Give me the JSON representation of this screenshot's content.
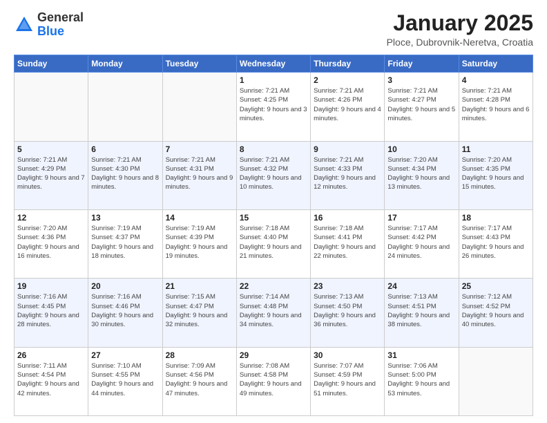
{
  "logo": {
    "general": "General",
    "blue": "Blue"
  },
  "header": {
    "month": "January 2025",
    "location": "Ploce, Dubrovnik-Neretva, Croatia"
  },
  "weekdays": [
    "Sunday",
    "Monday",
    "Tuesday",
    "Wednesday",
    "Thursday",
    "Friday",
    "Saturday"
  ],
  "weeks": [
    [
      {
        "day": "",
        "info": ""
      },
      {
        "day": "",
        "info": ""
      },
      {
        "day": "",
        "info": ""
      },
      {
        "day": "1",
        "info": "Sunrise: 7:21 AM\nSunset: 4:25 PM\nDaylight: 9 hours and 3 minutes."
      },
      {
        "day": "2",
        "info": "Sunrise: 7:21 AM\nSunset: 4:26 PM\nDaylight: 9 hours and 4 minutes."
      },
      {
        "day": "3",
        "info": "Sunrise: 7:21 AM\nSunset: 4:27 PM\nDaylight: 9 hours and 5 minutes."
      },
      {
        "day": "4",
        "info": "Sunrise: 7:21 AM\nSunset: 4:28 PM\nDaylight: 9 hours and 6 minutes."
      }
    ],
    [
      {
        "day": "5",
        "info": "Sunrise: 7:21 AM\nSunset: 4:29 PM\nDaylight: 9 hours and 7 minutes."
      },
      {
        "day": "6",
        "info": "Sunrise: 7:21 AM\nSunset: 4:30 PM\nDaylight: 9 hours and 8 minutes."
      },
      {
        "day": "7",
        "info": "Sunrise: 7:21 AM\nSunset: 4:31 PM\nDaylight: 9 hours and 9 minutes."
      },
      {
        "day": "8",
        "info": "Sunrise: 7:21 AM\nSunset: 4:32 PM\nDaylight: 9 hours and 10 minutes."
      },
      {
        "day": "9",
        "info": "Sunrise: 7:21 AM\nSunset: 4:33 PM\nDaylight: 9 hours and 12 minutes."
      },
      {
        "day": "10",
        "info": "Sunrise: 7:20 AM\nSunset: 4:34 PM\nDaylight: 9 hours and 13 minutes."
      },
      {
        "day": "11",
        "info": "Sunrise: 7:20 AM\nSunset: 4:35 PM\nDaylight: 9 hours and 15 minutes."
      }
    ],
    [
      {
        "day": "12",
        "info": "Sunrise: 7:20 AM\nSunset: 4:36 PM\nDaylight: 9 hours and 16 minutes."
      },
      {
        "day": "13",
        "info": "Sunrise: 7:19 AM\nSunset: 4:37 PM\nDaylight: 9 hours and 18 minutes."
      },
      {
        "day": "14",
        "info": "Sunrise: 7:19 AM\nSunset: 4:39 PM\nDaylight: 9 hours and 19 minutes."
      },
      {
        "day": "15",
        "info": "Sunrise: 7:18 AM\nSunset: 4:40 PM\nDaylight: 9 hours and 21 minutes."
      },
      {
        "day": "16",
        "info": "Sunrise: 7:18 AM\nSunset: 4:41 PM\nDaylight: 9 hours and 22 minutes."
      },
      {
        "day": "17",
        "info": "Sunrise: 7:17 AM\nSunset: 4:42 PM\nDaylight: 9 hours and 24 minutes."
      },
      {
        "day": "18",
        "info": "Sunrise: 7:17 AM\nSunset: 4:43 PM\nDaylight: 9 hours and 26 minutes."
      }
    ],
    [
      {
        "day": "19",
        "info": "Sunrise: 7:16 AM\nSunset: 4:45 PM\nDaylight: 9 hours and 28 minutes."
      },
      {
        "day": "20",
        "info": "Sunrise: 7:16 AM\nSunset: 4:46 PM\nDaylight: 9 hours and 30 minutes."
      },
      {
        "day": "21",
        "info": "Sunrise: 7:15 AM\nSunset: 4:47 PM\nDaylight: 9 hours and 32 minutes."
      },
      {
        "day": "22",
        "info": "Sunrise: 7:14 AM\nSunset: 4:48 PM\nDaylight: 9 hours and 34 minutes."
      },
      {
        "day": "23",
        "info": "Sunrise: 7:13 AM\nSunset: 4:50 PM\nDaylight: 9 hours and 36 minutes."
      },
      {
        "day": "24",
        "info": "Sunrise: 7:13 AM\nSunset: 4:51 PM\nDaylight: 9 hours and 38 minutes."
      },
      {
        "day": "25",
        "info": "Sunrise: 7:12 AM\nSunset: 4:52 PM\nDaylight: 9 hours and 40 minutes."
      }
    ],
    [
      {
        "day": "26",
        "info": "Sunrise: 7:11 AM\nSunset: 4:54 PM\nDaylight: 9 hours and 42 minutes."
      },
      {
        "day": "27",
        "info": "Sunrise: 7:10 AM\nSunset: 4:55 PM\nDaylight: 9 hours and 44 minutes."
      },
      {
        "day": "28",
        "info": "Sunrise: 7:09 AM\nSunset: 4:56 PM\nDaylight: 9 hours and 47 minutes."
      },
      {
        "day": "29",
        "info": "Sunrise: 7:08 AM\nSunset: 4:58 PM\nDaylight: 9 hours and 49 minutes."
      },
      {
        "day": "30",
        "info": "Sunrise: 7:07 AM\nSunset: 4:59 PM\nDaylight: 9 hours and 51 minutes."
      },
      {
        "day": "31",
        "info": "Sunrise: 7:06 AM\nSunset: 5:00 PM\nDaylight: 9 hours and 53 minutes."
      },
      {
        "day": "",
        "info": ""
      }
    ]
  ]
}
